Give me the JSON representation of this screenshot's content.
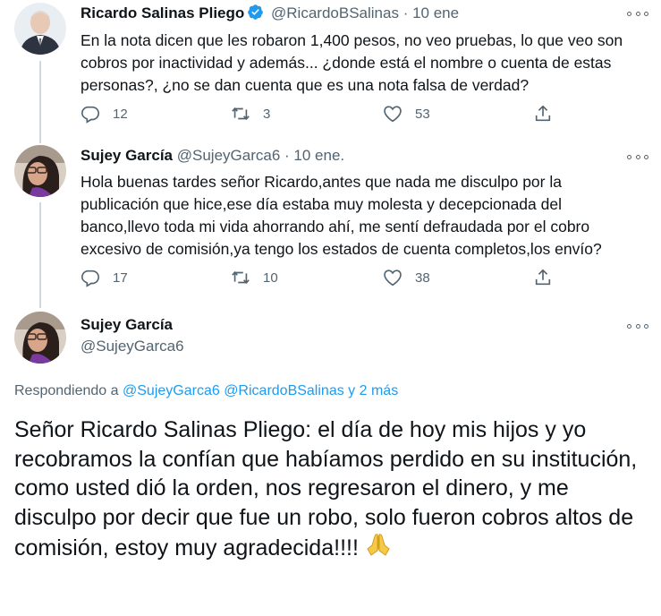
{
  "tweets": [
    {
      "name": "Ricardo Salinas Pliego",
      "handle": "@RicardoBSalinas",
      "separator": "·",
      "date": "10 ene",
      "verified": true,
      "text": "En la nota dicen que les robaron 1,400 pesos, no veo pruebas, lo que veo son cobros por inactividad y además... ¿donde está el nombre o cuenta de estas personas?, ¿no se dan cuenta que es una nota falsa de verdad?",
      "replies": "12",
      "retweets": "3",
      "likes": "53"
    },
    {
      "name": "Sujey García",
      "handle": "@SujeyGarca6",
      "separator": "·",
      "date": "10 ene.",
      "verified": false,
      "text": "Hola buenas tardes señor Ricardo,antes que nada me disculpo por la publicación que hice,ese día estaba muy molesta y decepcionada del banco,llevo toda mi vida ahorrando ahí, me sentí defraudada por el cobro excesivo de comisión,ya tengo los estados de cuenta completos,los envío?",
      "replies": "17",
      "retweets": "10",
      "likes": "38"
    }
  ],
  "main_tweet": {
    "name": "Sujey García",
    "handle": "@SujeyGarca6",
    "reply_prefix": "Respondiendo a",
    "reply_to_1": "@SujeyGarca6",
    "reply_to_2": "@RicardoBSalinas",
    "reply_suffix": "y 2 más",
    "text": "Señor Ricardo Salinas Pliego: el día de hoy mis hijos y yo recobramos la confían que habíamos perdido en su institución, como usted dió la orden, nos regresaron el dinero, y me disculpo por decir que fue un robo, solo fueron cobros altos de comisión, estoy muy agradecida!!!!",
    "emoji_icon": "folded-hands-icon"
  },
  "colors": {
    "text": "#0f1419",
    "secondary": "#536471",
    "link": "#1d9bf0",
    "verified": "#1d9bf0",
    "thread_line": "#cfd9de"
  }
}
